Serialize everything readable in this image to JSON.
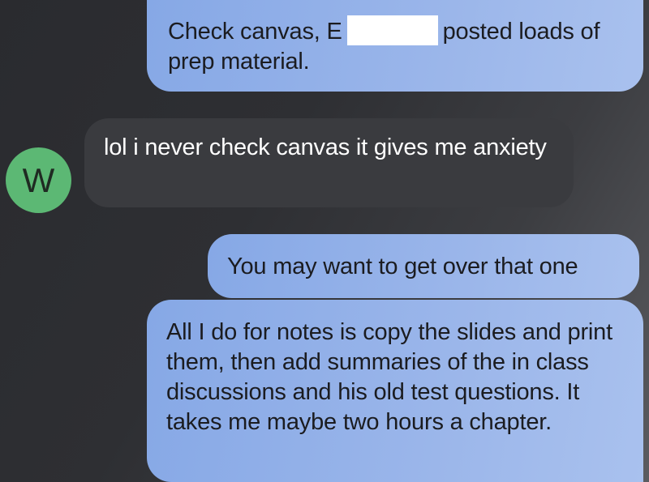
{
  "conversation": {
    "messages": [
      {
        "sender": "me",
        "text_before_redaction": "Check canvas,",
        "text_fragment": "E",
        "text_after_redaction": "posted loads of prep material."
      },
      {
        "sender": "W",
        "text": "lol i never check canvas it gives me anxiety"
      },
      {
        "sender": "me",
        "text": "You may want to get over that one"
      },
      {
        "sender": "me",
        "text": "All I do for notes is copy the slides and print them, then add summaries of the in class discussions and his old test questions. It takes me maybe two hours a chapter."
      }
    ],
    "contact_avatar_initial": "W",
    "colors": {
      "outgoing_bubble": "#8fadE8",
      "incoming_bubble": "#3a3b3f",
      "avatar": "#5cb874",
      "redaction": "#ffffff"
    }
  }
}
